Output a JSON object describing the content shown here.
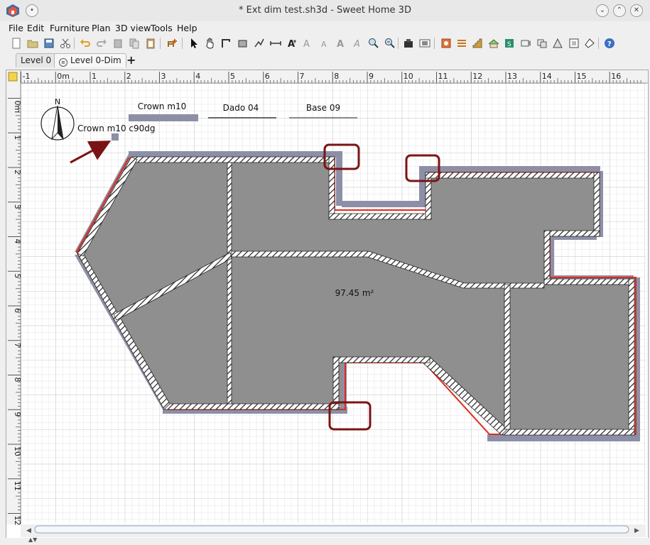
{
  "window": {
    "title": "* Ext dim test.sh3d - Sweet Home 3D",
    "buttons": [
      "minimize",
      "maximize",
      "close"
    ]
  },
  "menu": {
    "items": [
      "File",
      "Edit",
      "Furniture",
      "Plan",
      "3D view",
      "Tools",
      "Help"
    ]
  },
  "toolbar": {
    "icons": [
      "new-icon",
      "open-icon",
      "save-icon",
      "cut-icon",
      "undo-icon",
      "redo-icon",
      "delete-icon",
      "copy-icon",
      "paste-icon",
      "add-furniture-icon",
      "select-icon",
      "pan-icon",
      "create-walls-icon",
      "create-rooms-icon",
      "create-polylines-icon",
      "create-dimensions-icon",
      "add-text-icon",
      "increase-text-icon",
      "decrease-text-icon",
      "bold-icon",
      "italic-icon",
      "zoom-in-icon",
      "zoom-out-icon",
      "import-furniture-icon",
      "import-background-icon",
      "compass-icon",
      "level-icon",
      "stairs-icon",
      "roof-icon",
      "export-icon",
      "photo-icon",
      "video-icon",
      "preferences-icon",
      "help-icon"
    ]
  },
  "tabs": {
    "items": [
      "Level 0",
      "Level 0-Dim"
    ],
    "add": "+"
  },
  "plan": {
    "ruler_h": [
      "-1",
      "0m",
      "1",
      "2",
      "3",
      "4",
      "5",
      "6",
      "7",
      "8",
      "9",
      "10",
      "11",
      "12",
      "13",
      "14",
      "15",
      "16"
    ],
    "ruler_v": [
      "0m",
      "1",
      "2",
      "3",
      "4",
      "5",
      "6",
      "7",
      "8",
      "9",
      "10",
      "11",
      "12"
    ],
    "room_area": "97.45 m²",
    "labels": {
      "crown": "Crown m10",
      "dado": "Dado 04",
      "base": "Base 09",
      "crown_c90": "Crown m10 c90dg"
    },
    "compass_n": "N",
    "colors": {
      "grid_minor": "#e3e3e3",
      "grid_major": "#c8c8c8",
      "room_fill": "#8f8f8f",
      "wall_hatch": "#222222",
      "dim_red": "#e02a1b",
      "dim_gray": "#8d8fa6",
      "highlight": "#7a1414"
    }
  }
}
